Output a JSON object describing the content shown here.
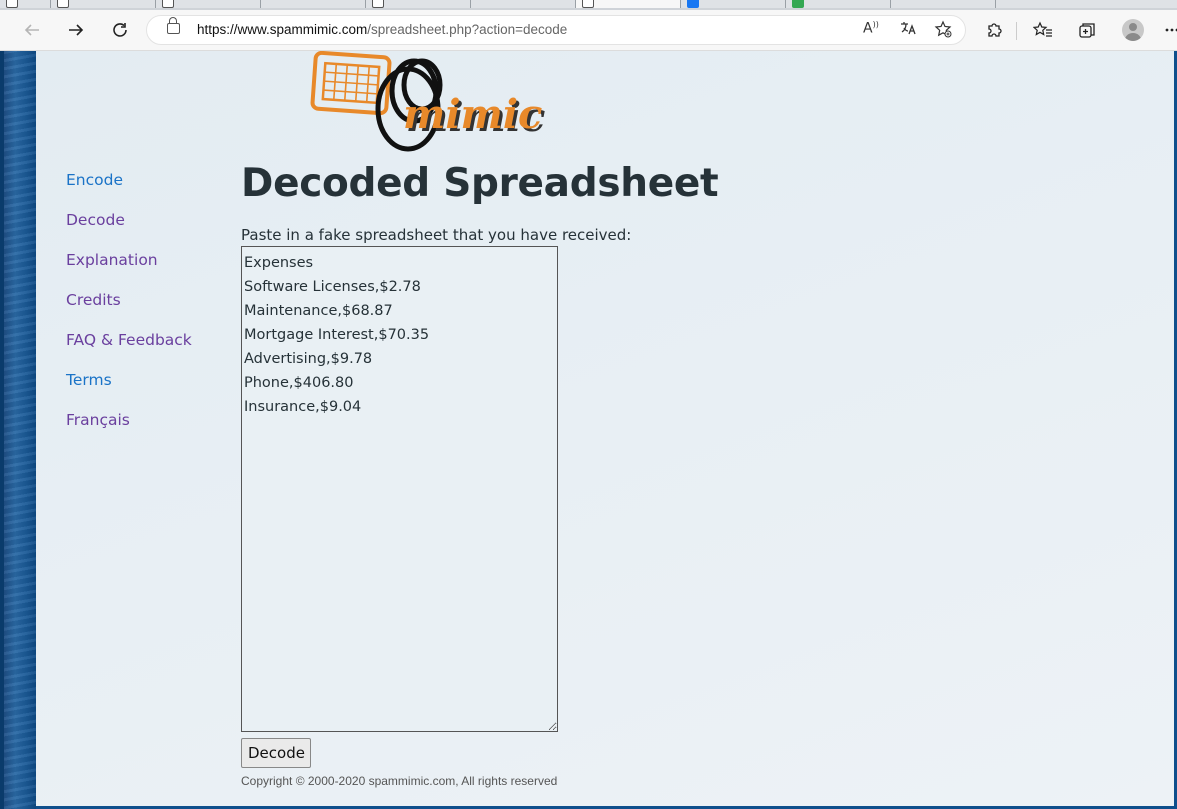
{
  "browser": {
    "url_host": "https://www.spammimic.com",
    "url_path": "/spreadsheet.php?action=decode"
  },
  "site": {
    "logo_text": "mimic",
    "brand_color": "#e8892a"
  },
  "nav": {
    "items": [
      {
        "label": "Encode"
      },
      {
        "label": "Decode"
      },
      {
        "label": "Explanation"
      },
      {
        "label": "Credits"
      },
      {
        "label": "FAQ & Feedback"
      },
      {
        "label": "Terms"
      },
      {
        "label": "Français"
      }
    ]
  },
  "main": {
    "title": "Decoded Spreadsheet",
    "prompt": "Paste in a fake spreadsheet that you have received:",
    "textarea_value": "Expenses\nSoftware Licenses,$2.78\nMaintenance,$68.87\nMortgage Interest,$70.35\nAdvertising,$9.78\nPhone,$406.80\nInsurance,$9.04",
    "decode_label": "Decode",
    "copyright": "Copyright © 2000-2020 spammimic.com, All rights reserved"
  }
}
